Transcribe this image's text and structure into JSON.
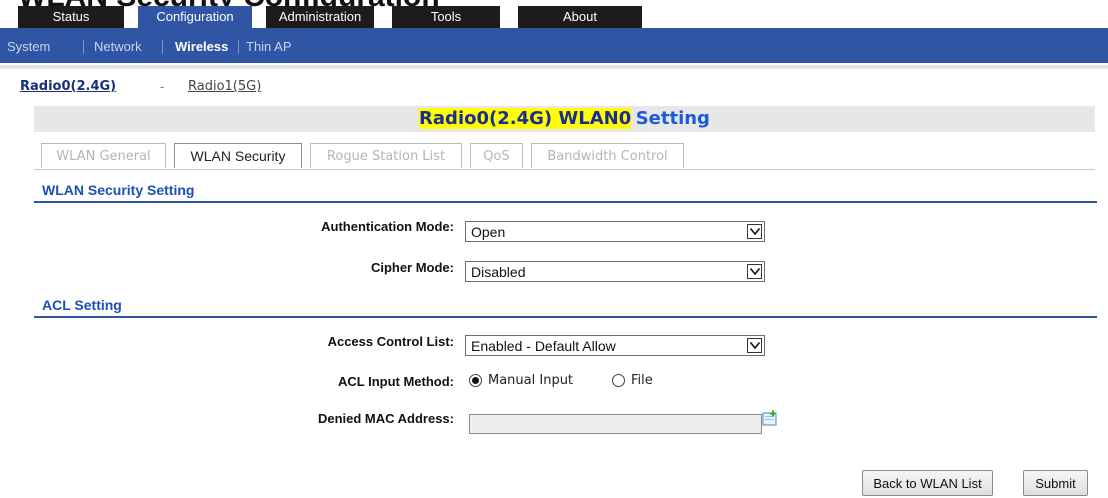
{
  "header": {
    "cropped_heading": "WLAN Security Configuration",
    "tabs": [
      {
        "label": "Status"
      },
      {
        "label": "Configuration"
      },
      {
        "label": "Administration"
      },
      {
        "label": "Tools"
      },
      {
        "label": "About"
      }
    ],
    "active_tab": "Configuration"
  },
  "subnav": {
    "items": [
      {
        "label": "System"
      },
      {
        "label": "Network"
      },
      {
        "label": "Wireless"
      },
      {
        "label": "Thin AP"
      }
    ],
    "active": "Wireless"
  },
  "radios": {
    "r0": "Radio0(2.4G)",
    "dash": "-",
    "r1": "Radio1(5G)",
    "active": "Radio0(2.4G)"
  },
  "title": {
    "highlight": "Radio0(2.4G) WLAN0",
    "rest": "Setting"
  },
  "subtabs": {
    "items": [
      {
        "label": "WLAN General"
      },
      {
        "label": "WLAN Security"
      },
      {
        "label": "Rogue Station List"
      },
      {
        "label": "QoS"
      },
      {
        "label": "Bandwidth Control"
      }
    ],
    "active": "WLAN Security"
  },
  "security": {
    "heading": "WLAN Security Setting",
    "auth_label": "Authentication Mode:",
    "auth_value": "Open",
    "cipher_label": "Cipher Mode:",
    "cipher_value": "Disabled"
  },
  "acl": {
    "heading": "ACL Setting",
    "list_label": "Access Control List:",
    "list_value": "Enabled - Default Allow",
    "method_label": "ACL Input Method:",
    "method_manual": "Manual Input",
    "method_file": "File",
    "method_selected": "Manual Input",
    "mac_label": "Denied MAC Address:",
    "mac_value": ""
  },
  "buttons": {
    "back": "Back to WLAN List",
    "submit": "Submit"
  },
  "colors": {
    "nav_blue": "#2f55a4",
    "section_blue": "#1b4fb5",
    "highlight_yellow": "#ffff00"
  }
}
